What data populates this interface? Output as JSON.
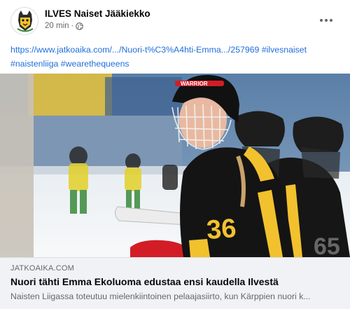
{
  "post": {
    "page_name": "ILVES Naiset Jääkiekko",
    "timestamp": "20 min",
    "separator": "·",
    "privacy_icon": "globe-icon",
    "more_icon": "more-horizontal-icon",
    "avatar_icon": "ilves-lynx-logo",
    "caption": {
      "url": "https://www.jatkoaika.com/.../Nuori-t%C3%A4hti-Emma.../257969",
      "hashtags": [
        "#ilvesnaiset",
        "#naistenliiga",
        "#wearethequeens"
      ]
    },
    "photo": {
      "jersey_number": "36",
      "watermark": "65",
      "helmet_brand": "WARRIOR"
    },
    "link_preview": {
      "domain": "JATKOAIKA.COM",
      "title": "Nuori tähti Emma Ekoluoma edustaa ensi kaudella Ilvestä",
      "description": "Naisten Liigassa toteutuu mielenkiintoinen pelaajasiirto, kun Kärppien nuori k..."
    }
  },
  "colors": {
    "link": "#216fdb",
    "secondary_text": "#65676b",
    "preview_bg": "#f0f2f5",
    "jersey_black": "#141414",
    "jersey_yellow": "#f2c12e"
  }
}
